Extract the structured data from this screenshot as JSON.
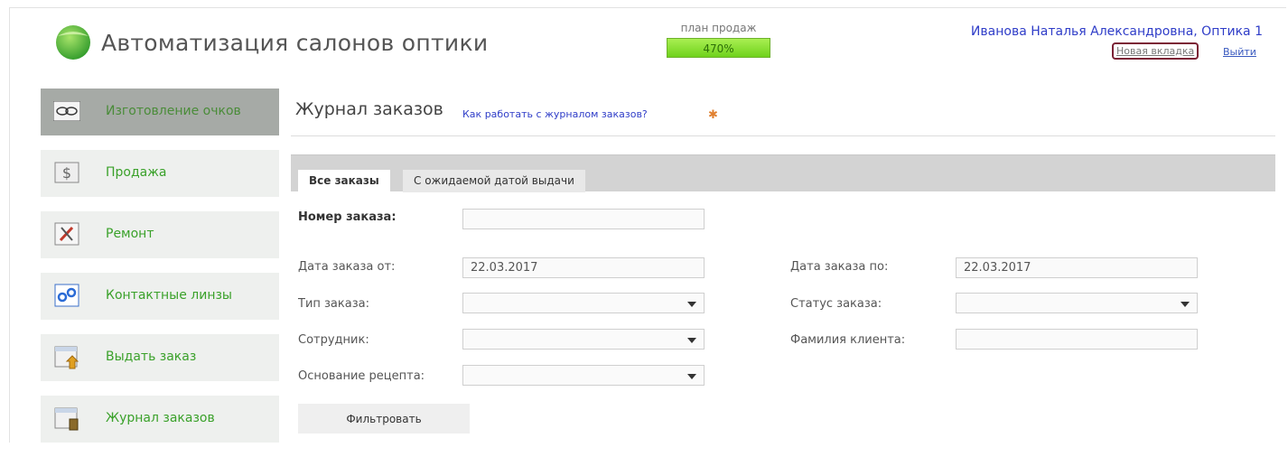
{
  "header": {
    "app_title": "Автоматизация салонов оптики",
    "sales_plan_label": "план продаж",
    "sales_plan_value": "470%",
    "user": "Иванова Наталья Александровна, Оптика 1",
    "new_tab": "Новая вкладка",
    "logout": "Выйти"
  },
  "sidebar": {
    "items": [
      {
        "label": "Изготовление очков",
        "icon": "glasses-icon",
        "active": true
      },
      {
        "label": "Продажа",
        "icon": "dollar-icon"
      },
      {
        "label": "Ремонт",
        "icon": "tools-icon"
      },
      {
        "label": "Контактные линзы",
        "icon": "contact-lens-icon"
      },
      {
        "label": "Выдать заказ",
        "icon": "issue-order-icon"
      },
      {
        "label": "Журнал заказов",
        "icon": "order-journal-icon"
      }
    ]
  },
  "main": {
    "title": "Журнал заказов",
    "help_link": "Как работать с журналом заказов?",
    "tabs": [
      {
        "label": "Все заказы",
        "active": true
      },
      {
        "label": "С ожидаемой датой выдачи"
      }
    ],
    "form": {
      "order_number_label": "Номер заказа:",
      "order_number_value": "",
      "date_from_label": "Дата заказа от:",
      "date_from_value": "22.03.2017",
      "date_to_label": "Дата заказа по:",
      "date_to_value": "22.03.2017",
      "order_type_label": "Тип заказа:",
      "order_status_label": "Статус заказа:",
      "employee_label": "Сотрудник:",
      "client_surname_label": "Фамилия клиента:",
      "client_surname_value": "",
      "prescription_label": "Основание рецепта:",
      "filter_button": "Фильтровать"
    }
  },
  "colors": {
    "accent_green": "#3aa12a",
    "link_blue": "#2f3dc8",
    "sales_bar": "#8be23a"
  }
}
